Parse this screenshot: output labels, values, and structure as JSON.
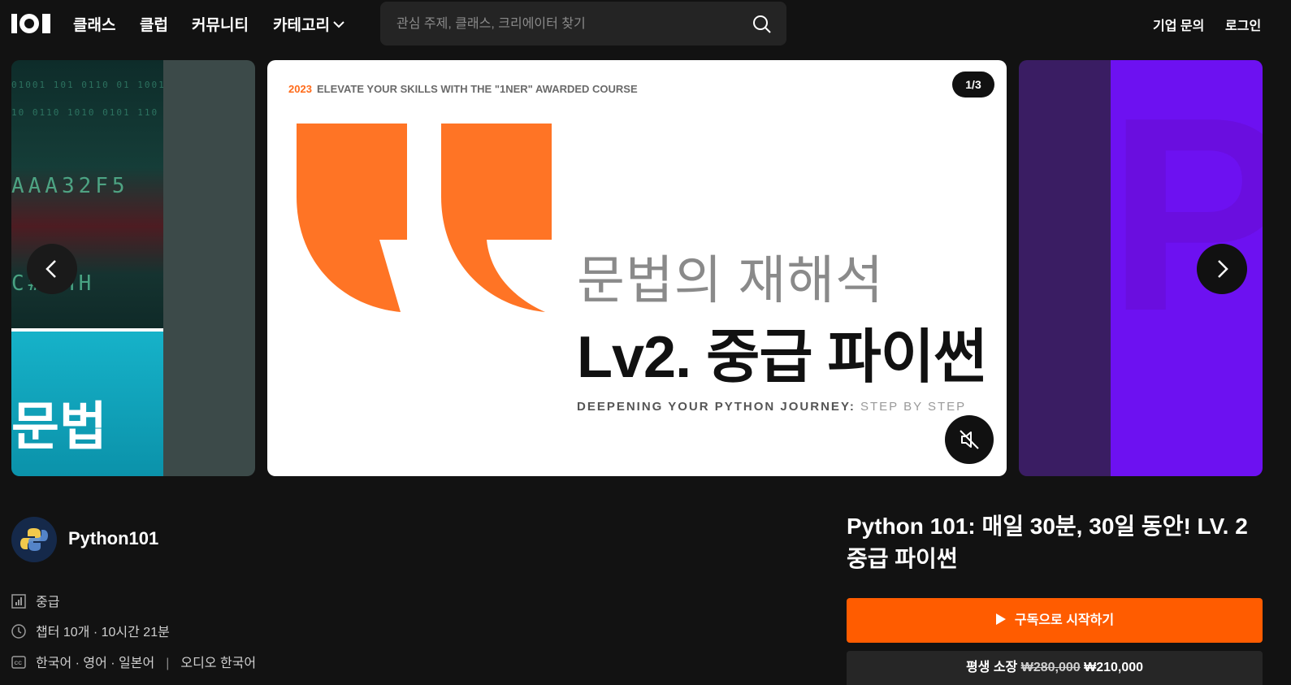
{
  "nav": {
    "items": [
      {
        "label": "클래스"
      },
      {
        "label": "클럽"
      },
      {
        "label": "커뮤니티"
      },
      {
        "label": "카테고리"
      }
    ],
    "search_placeholder": "관심 주제, 클래스, 크리에이터 찾기",
    "enterprise_label": "기업 문의",
    "login_label": "로그인"
  },
  "carousel": {
    "left_slide": {
      "code_rows": [
        "AAA32F5",
        "C# HH"
      ],
      "text": "문법"
    },
    "main_slide": {
      "year": "2023",
      "tagline": "ELEVATE YOUR SKILLS WITH THE \"1NER\" AWARDED COURSE",
      "counter": "1/3",
      "subtitle": "문법의 재해석",
      "title": "Lv2. 중급 파이썬",
      "footer_bold": "DEEPENING YOUR PYTHON JOURNEY:",
      "footer_light": " STEP BY STEP",
      "quote_color": "#ff7425"
    },
    "right_slide": {
      "letters": "PY",
      "accent": "#6d11f1"
    }
  },
  "creator": {
    "name": "Python101"
  },
  "meta": {
    "level": "중급",
    "duration": "챕터 10개 · 10시간 21분",
    "subtitles": "한국어 · 영어 · 일본어",
    "separator": "|",
    "audio": "오디오 한국어"
  },
  "course": {
    "title": "Python 101: 매일 30분, 30일 동안! LV. 2 중급 파이썬",
    "cta_label": "구독으로 시작하기",
    "price_prefix": "평생 소장",
    "original_price": "₩280,000",
    "sale_price": "₩210,000"
  },
  "colors": {
    "accent": "#ff5c00",
    "background": "#121212"
  }
}
